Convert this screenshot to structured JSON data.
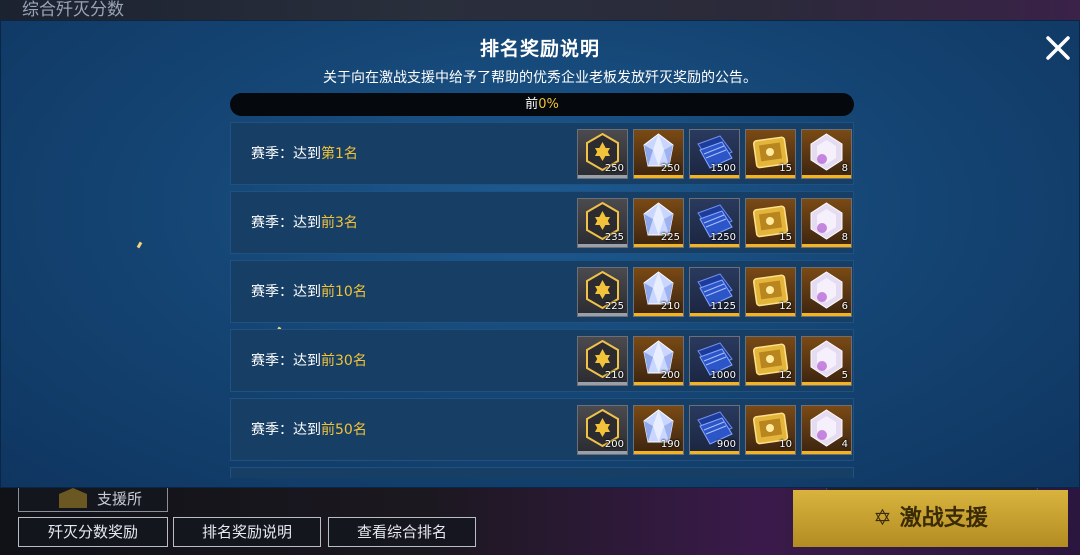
{
  "background": {
    "top_title": "综合歼灭分数",
    "support_label": "支援所",
    "tabs": [
      "歼灭分数奖励",
      "排名奖励说明",
      "查看综合排名"
    ],
    "big_button": "激战支援"
  },
  "modal": {
    "title": "排名奖励说明",
    "subtitle": "关于向在激战支援中给予了帮助的优秀企业老板发放歼灭奖励的公告。",
    "progress": {
      "prefix": "前",
      "value": "0%"
    },
    "close_icon": "close-icon",
    "colors": {
      "gold": "#f2c33a",
      "panel": "#154675"
    },
    "rows": [
      {
        "label": "赛季：达到",
        "rank": "第1名",
        "rewards": [
          "250",
          "250",
          "1500",
          "15",
          "8"
        ]
      },
      {
        "label": "赛季：达到",
        "rank": "前3名",
        "rewards": [
          "235",
          "225",
          "1250",
          "15",
          "8"
        ]
      },
      {
        "label": "赛季：达到",
        "rank": "前10名",
        "rewards": [
          "225",
          "210",
          "1125",
          "12",
          "6"
        ]
      },
      {
        "label": "赛季：达到",
        "rank": "前30名",
        "rewards": [
          "210",
          "200",
          "1000",
          "12",
          "5"
        ]
      },
      {
        "label": "赛季：达到",
        "rank": "前50名",
        "rewards": [
          "200",
          "190",
          "900",
          "10",
          "4"
        ]
      }
    ],
    "reward_icons": [
      "star-badge-icon",
      "crystal-icon",
      "blue-book-icon",
      "gold-scroll-icon",
      "purple-gem-icon"
    ]
  }
}
